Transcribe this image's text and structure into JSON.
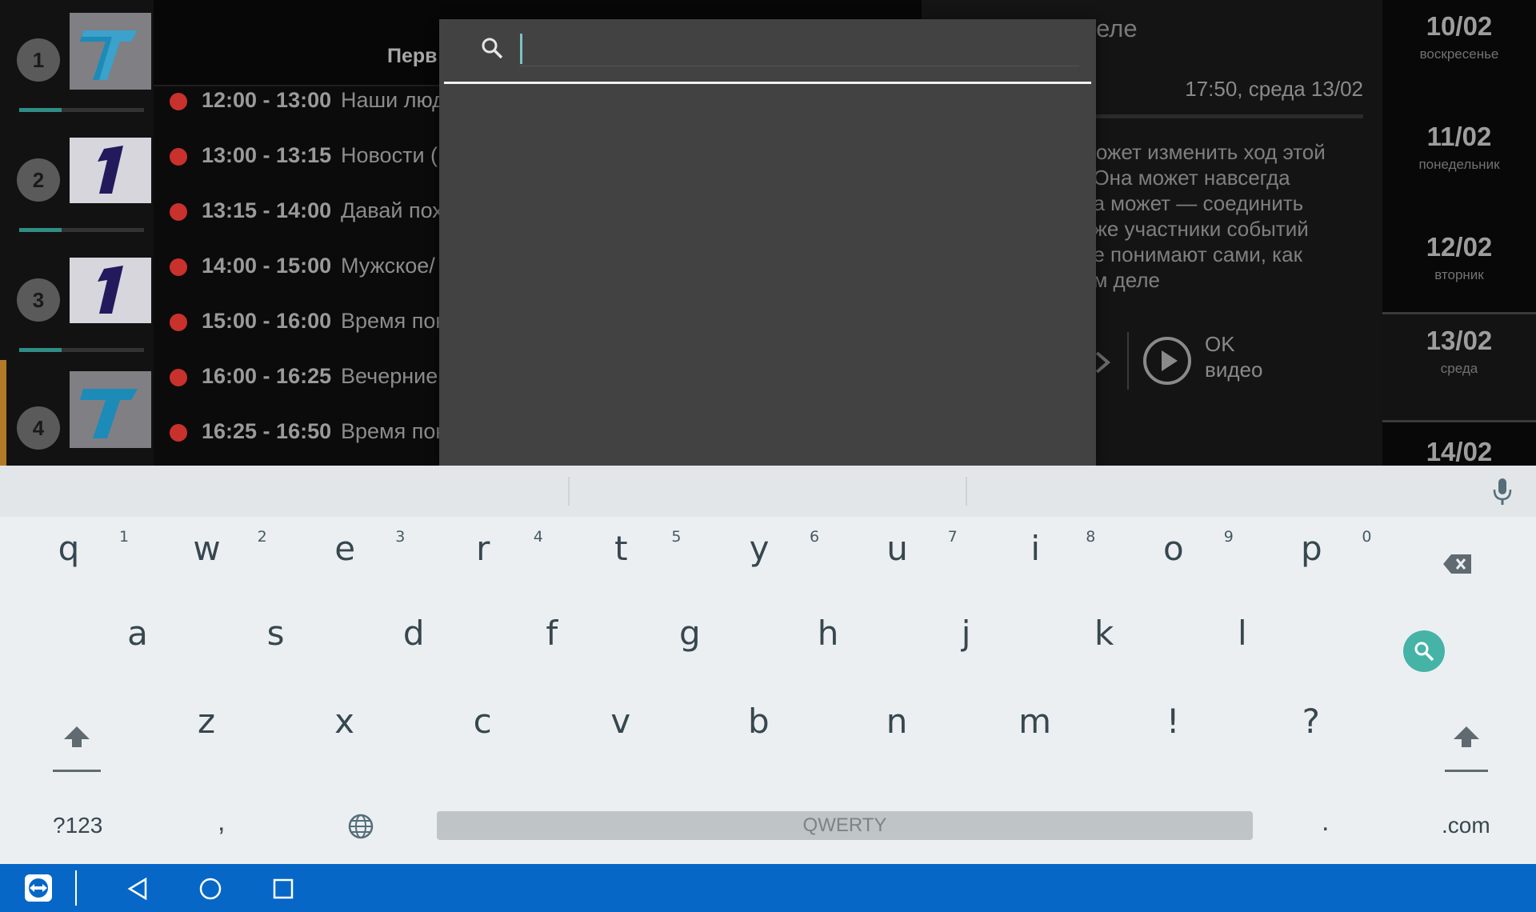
{
  "channels": [
    {
      "number": "1",
      "progress": 0.34
    },
    {
      "number": "2",
      "progress": 0.34
    },
    {
      "number": "3",
      "progress": 0.34
    },
    {
      "number": "4",
      "progress": 0.0
    }
  ],
  "programs": {
    "header_title": "Перв",
    "rows": [
      {
        "time": "12:00 - 13:00",
        "name": "Наши люд"
      },
      {
        "time": "13:00 - 13:15",
        "name": "Новости ("
      },
      {
        "time": "13:15 - 14:00",
        "name": "Давай пох"
      },
      {
        "time": "14:00 - 15:00",
        "name": "Мужское/"
      },
      {
        "time": "15:00 - 16:00",
        "name": "Время пок"
      },
      {
        "time": "16:00 - 16:25",
        "name": "Вечерние"
      },
      {
        "time": "16:25 - 16:50",
        "name": "Время пок"
      }
    ]
  },
  "details": {
    "title": "деле",
    "time": "17:50, среда 13/02",
    "description": "может изменить ход этой\n. Она может навсегда\n, а может — соединить\nаже участники событий\nне понимают сами, как\nом деле",
    "ok_video_line1": "OK",
    "ok_video_line2": "видео"
  },
  "dates": [
    {
      "day": "10/02",
      "weekday": "воскресенье"
    },
    {
      "day": "11/02",
      "weekday": "понедельник"
    },
    {
      "day": "12/02",
      "weekday": "вторник"
    },
    {
      "day": "13/02",
      "weekday": "среда"
    },
    {
      "day": "14/02",
      "weekday": ""
    }
  ],
  "search": {
    "value": "",
    "placeholder": ""
  },
  "keyboard": {
    "row1": [
      "q",
      "w",
      "e",
      "r",
      "t",
      "y",
      "u",
      "i",
      "o",
      "p"
    ],
    "row1_hints": [
      "1",
      "2",
      "3",
      "4",
      "5",
      "6",
      "7",
      "8",
      "9",
      "0"
    ],
    "row2": [
      "a",
      "s",
      "d",
      "f",
      "g",
      "h",
      "j",
      "k",
      "l"
    ],
    "row3": [
      "z",
      "x",
      "c",
      "v",
      "b",
      "n",
      "m",
      "!",
      "?"
    ],
    "symbols_label": "?123",
    "comma": ",",
    "period": ".",
    "space_label": "QWERTY",
    "dotcom_label": ".com"
  },
  "colors": {
    "accent_teal": "#45b3a6",
    "nav_blue": "#0767c7",
    "live_dot": "#c9312c",
    "active_channel": "#b27a27"
  }
}
